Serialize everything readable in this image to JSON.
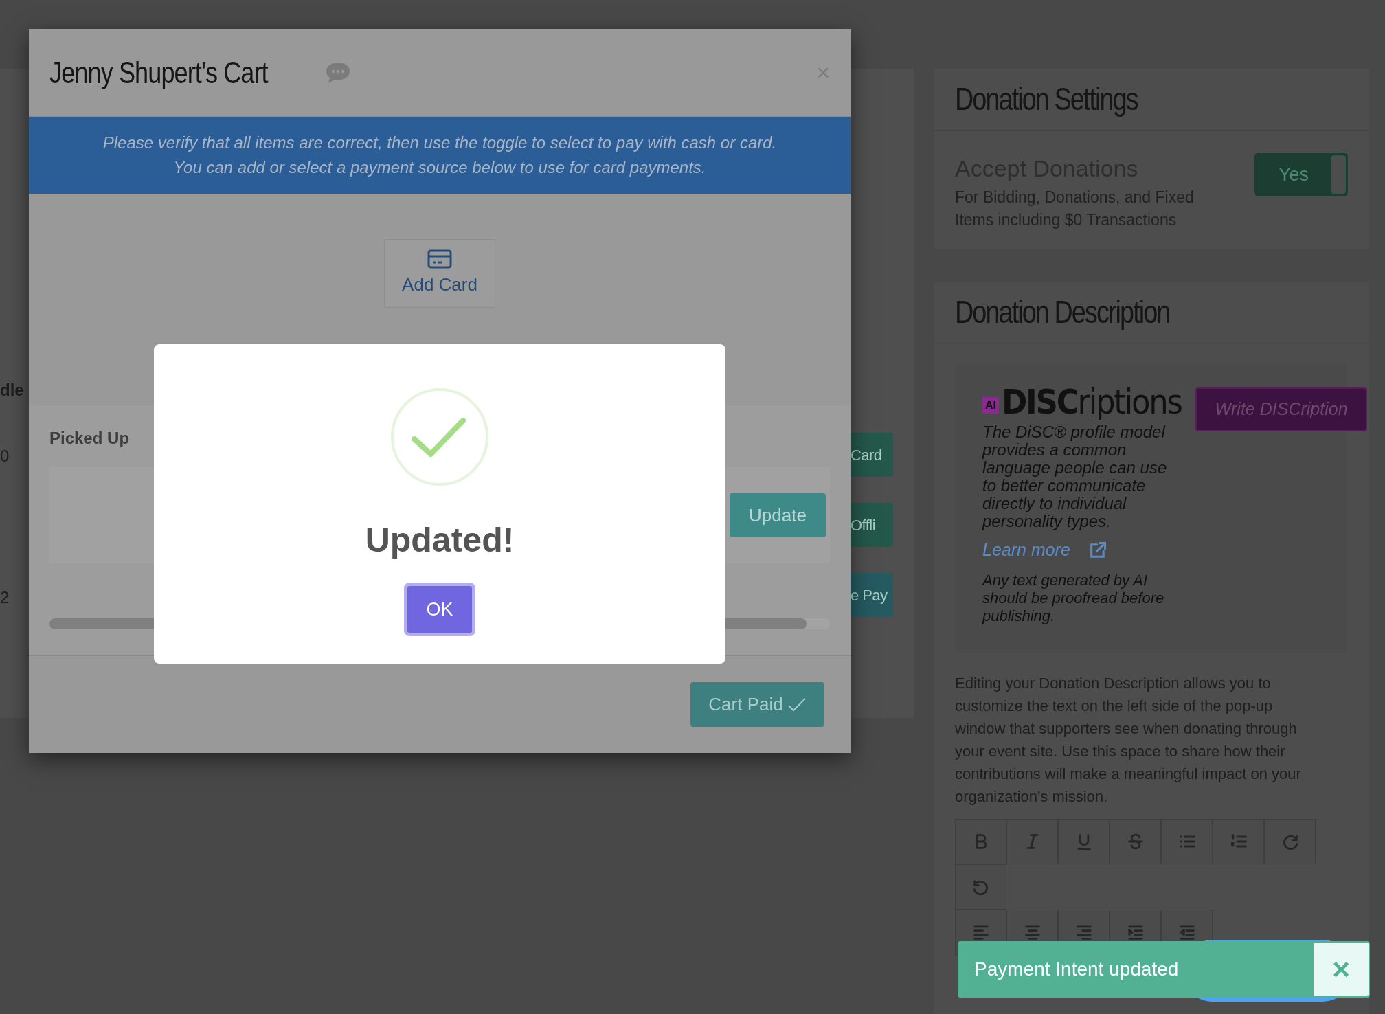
{
  "background_page": {
    "left_fragments": [
      "dle",
      "0",
      "2"
    ],
    "right_fragments": [
      {
        "label": "Card",
        "kind": "card"
      },
      {
        "label": "Offli",
        "kind": "offline"
      },
      {
        "label": "e Pay",
        "kind": "pay"
      }
    ]
  },
  "cart_modal": {
    "title": "Jenny Shupert's Cart",
    "close": "×",
    "banner_lines": [
      "Please verify that all items are correct, then use the toggle to select to pay with cash or card.",
      "You can add or select a payment source below to use for card payments."
    ],
    "add_card": "Add Card",
    "picked_up_label": "Picked Up",
    "update_button": "Update",
    "cart_paid_button": "Cart Paid"
  },
  "alert": {
    "title": "Updated!",
    "button": "OK"
  },
  "donation_settings": {
    "title": "Donation Settings",
    "setting": {
      "label": "Accept Donations",
      "description": "For Bidding, Donations, and Fixed Items including $0 Transactions",
      "toggle": {
        "label": "Yes",
        "on": true
      }
    }
  },
  "donation_description": {
    "title": "Donation Description",
    "discriptions": {
      "badge": "AI",
      "logo_bold": "DISC",
      "logo_rest": "riptions",
      "button": "Write DISCription",
      "text": "The DiSC® profile model provides a common language people can use to better communicate directly to individual personality types.",
      "link": "Learn more",
      "note": "Any text generated by AI should be proofread before publishing."
    },
    "help_text": "Editing your Donation Description allows you to customize the text on the left side of the pop-up window that supporters see when donating through your event site. Use this space to share how their contributions will make a meaningful impact on your organization’s mission.",
    "toolbar_rows": [
      [
        {
          "kind": "bold"
        },
        {
          "kind": "italic"
        },
        {
          "kind": "underline"
        },
        {
          "kind": "strike"
        },
        {
          "kind": "bullets"
        },
        {
          "kind": "numbers"
        },
        {
          "kind": "redo"
        }
      ],
      [
        {
          "kind": "undo"
        }
      ],
      [
        {
          "kind": "align-left"
        },
        {
          "kind": "align-center"
        },
        {
          "kind": "align-right"
        },
        {
          "kind": "indent"
        },
        {
          "kind": "outdent"
        }
      ]
    ]
  },
  "toast": {
    "message": "Payment Intent updated",
    "close": "×"
  }
}
